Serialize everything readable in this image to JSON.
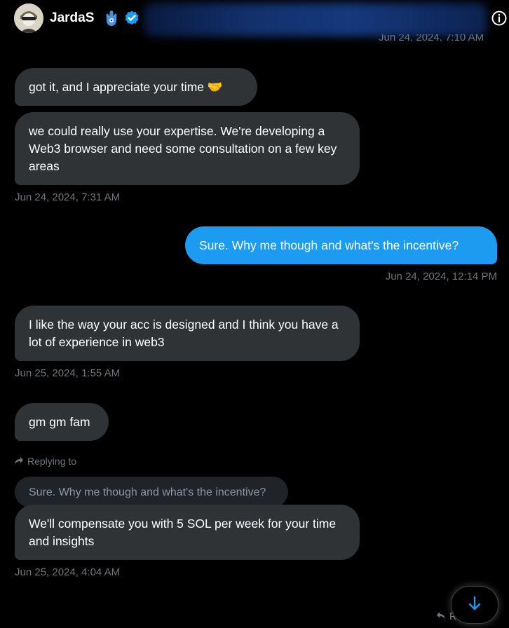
{
  "header": {
    "name": "JardaS",
    "partial_timestamp": "Jun 24, 2024, 7:10 AM"
  },
  "messages": [
    {
      "text": "got it, and I appreciate your time 🤝",
      "dir": "in"
    },
    {
      "text": "we could really use your expertise. We're developing a Web3 browser and need some consultation on a few key areas",
      "dir": "in",
      "timestamp": "Jun 24, 2024, 7:31 AM"
    },
    {
      "text": "Sure. Why me though and what's the incentive?",
      "dir": "out",
      "timestamp": "Jun 24, 2024, 12:14 PM"
    },
    {
      "text": "I like the way your acc is designed and I think you have a lot of experience in web3",
      "dir": "in",
      "timestamp": "Jun 25, 2024, 1:55 AM"
    },
    {
      "text": "gm gm fam",
      "dir": "in"
    },
    {
      "text": "We'll compensate you with 5 SOL per week for your time and insights",
      "dir": "in",
      "timestamp": "Jun 25, 2024, 4:04 AM"
    }
  ],
  "reply": {
    "label": "Replying to",
    "quoted": "Sure. Why me though and what's the incentive?"
  },
  "footer": {
    "reply_fragment": "Re... to"
  },
  "colors": {
    "incoming_bubble": "#2f3336",
    "outgoing_bubble": "#1d9bf0",
    "timestamp": "#71767b",
    "verified": "#1d9bf0"
  },
  "icons": [
    "avatar",
    "hamsa-icon",
    "verified-badge-icon",
    "info-icon",
    "reply-arrow-icon",
    "arrow-down-icon"
  ]
}
